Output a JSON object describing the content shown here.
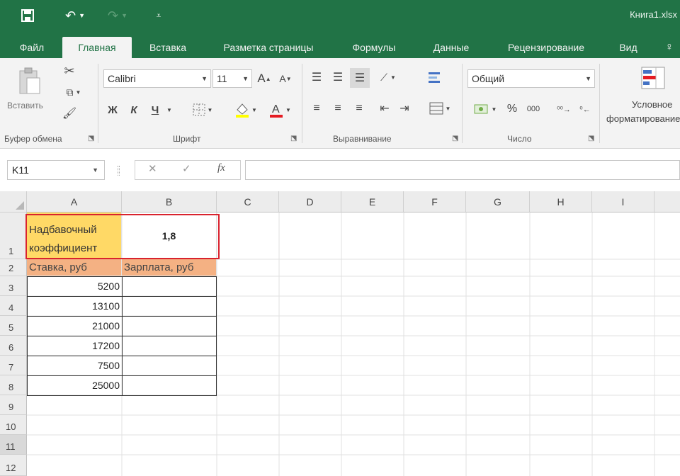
{
  "window": {
    "title": "Книга1.xlsx"
  },
  "quick_access": {
    "save_icon": "save-icon",
    "undo_icon": "undo-icon",
    "redo_icon": "redo-icon",
    "customize_icon": "customize-icon"
  },
  "tabs": [
    "Файл",
    "Главная",
    "Вставка",
    "Разметка страницы",
    "Формулы",
    "Данные",
    "Рецензирование",
    "Вид"
  ],
  "active_tab": "Главная",
  "ribbon": {
    "clipboard": {
      "paste_label": "Вставить",
      "group_label": "Буфер обмена"
    },
    "font": {
      "font_name": "Calibri",
      "font_size": "11",
      "increase": "A",
      "decrease": "A",
      "bold": "Ж",
      "italic": "К",
      "underline": "Ч",
      "group_label": "Шрифт"
    },
    "alignment": {
      "group_label": "Выравнивание"
    },
    "number": {
      "format": "Общий",
      "percent": "%",
      "thousands": "000",
      "group_label": "Число"
    },
    "styles": {
      "conditional_line1": "Условное",
      "conditional_line2": "форматирование"
    }
  },
  "formula_bar": {
    "name_box": "K11",
    "cancel": "✕",
    "enter": "✓",
    "fx": "fx",
    "value": ""
  },
  "columns": [
    "A",
    "B",
    "C",
    "D",
    "E",
    "F",
    "G",
    "H",
    "I"
  ],
  "rows": [
    "1",
    "2",
    "3",
    "4",
    "5",
    "6",
    "7",
    "8",
    "9",
    "10",
    "11",
    "12"
  ],
  "cells": {
    "A1_line1": "Надбавочный",
    "A1_line2": "коэффициент",
    "B1": "1,8",
    "A2": "Ставка, руб",
    "B2": "Зарплата, руб",
    "A3": "5200",
    "A4": "13100",
    "A5": "21000",
    "A6": "17200",
    "A7": "7500",
    "A8": "25000"
  },
  "colors": {
    "brand": "#217346",
    "header_fill": "#f4b183",
    "label_fill": "#ffd966",
    "highlight": "#d9232e"
  }
}
